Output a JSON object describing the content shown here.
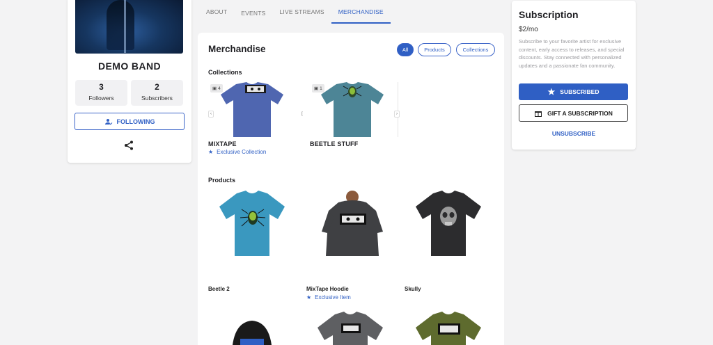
{
  "profile": {
    "band_name": "DEMO BAND",
    "followers_count": "3",
    "followers_label": "Followers",
    "subscribers_count": "2",
    "subscribers_label": "Subscribers",
    "follow_button": "FOLLOWING"
  },
  "tabs": [
    {
      "label": "ABOUT"
    },
    {
      "label": "EVENTS"
    },
    {
      "label": "LIVE STREAMS"
    },
    {
      "label": "MERCHANDISE"
    }
  ],
  "merch": {
    "title": "Merchandise",
    "filters": [
      "All",
      "Products",
      "Collections"
    ],
    "collections_title": "Collections",
    "collections": [
      {
        "name": "MIXTAPE",
        "count": "4",
        "tag": "Exclusive Collection",
        "shirt_color": "#4f66b0"
      },
      {
        "name": "BEETLE STUFF",
        "count": "1",
        "shirt_color": "#4d8596"
      }
    ],
    "products_title": "Products",
    "products": [
      {
        "name": "Beetle 2",
        "color": "#3a98bf"
      },
      {
        "name": "MixTape Hoodie",
        "tag": "Exclusive Item",
        "color": "#3f4043"
      },
      {
        "name": "Skully",
        "color": "#2c2c2e"
      }
    ]
  },
  "subscription": {
    "title": "Subscription",
    "price": "$2/mo",
    "description": "Subscribe to your favorite artist for exclusive content, early access to releases, and special discounts. Stay connected with personalized updates and a passionate fan community.",
    "subscribed_button": "SUBSCRIBED",
    "gift_button": "GIFT A SUBSCRIPTION",
    "unsubscribe": "UNSUBSCRIBE"
  },
  "colors": {
    "accent": "#2f5fc4",
    "page_bg": "#f3f3f4"
  }
}
